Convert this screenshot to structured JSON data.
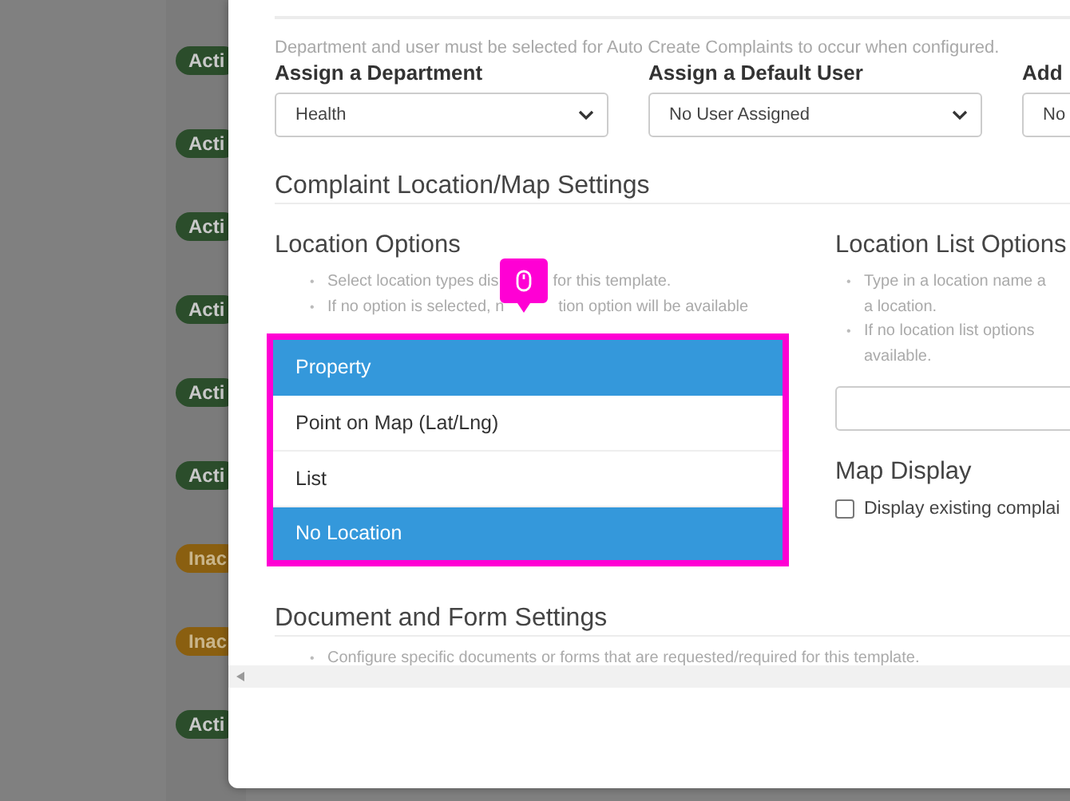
{
  "backdrop": {
    "status_badges": [
      {
        "label": "Acti",
        "kind": "active"
      },
      {
        "label": "Acti",
        "kind": "active"
      },
      {
        "label": "Acti",
        "kind": "active"
      },
      {
        "label": "Acti",
        "kind": "active"
      },
      {
        "label": "Acti",
        "kind": "active"
      },
      {
        "label": "Acti",
        "kind": "active"
      },
      {
        "label": "Inac",
        "kind": "inactive"
      },
      {
        "label": "Inac",
        "kind": "inactive"
      },
      {
        "label": "Acti",
        "kind": "active"
      }
    ]
  },
  "modal": {
    "bullet": "•",
    "auto_create_hint": "Department and user must be selected for Auto Create Complaints to occur when configured.",
    "assign_fields": [
      {
        "label": "Assign a Department",
        "value": "Health"
      },
      {
        "label": "Assign a Default User",
        "value": "No User Assigned"
      },
      {
        "label": "Add",
        "value": "No"
      }
    ],
    "location_section": {
      "title": "Complaint Location/Map Settings",
      "location_options": {
        "title": "Location Options",
        "hints": [
          {
            "before": "Select location types dis",
            "after": "for this template."
          },
          {
            "before": "If no option is selected, n",
            "after": "tion option will be available"
          }
        ],
        "options": [
          {
            "label": "Property",
            "selected": true
          },
          {
            "label": "Point on Map (Lat/Lng)",
            "selected": false
          },
          {
            "label": "List",
            "selected": false
          },
          {
            "label": "No Location",
            "selected": true
          }
        ]
      },
      "location_list_options": {
        "title": "Location List Options",
        "hints": [
          [
            "Type in a location name a",
            "a location."
          ],
          [
            "If no location list options",
            "available."
          ]
        ]
      },
      "map_display": {
        "title": "Map Display",
        "checkbox": {
          "label": "Display existing complai",
          "checked": false
        }
      }
    },
    "document_section": {
      "title": "Document and Form Settings",
      "hint": "Configure specific documents or forms that are requested/required for this template."
    }
  }
}
